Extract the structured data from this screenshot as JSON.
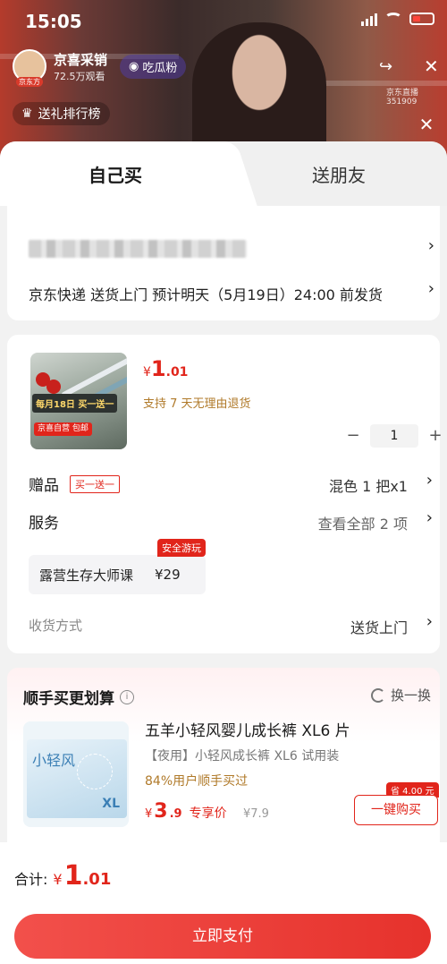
{
  "status_bar": {
    "time": "15:05"
  },
  "live": {
    "host_name": "京喜采销",
    "host_views": "72.5万观看",
    "follow_label": "吃瓜粉",
    "rank_label": "送礼排行榜",
    "live_id": "京东直播 351909"
  },
  "tabs": [
    {
      "label": "自己买"
    },
    {
      "label": "送朋友"
    }
  ],
  "address": {
    "delivery": "京东快递 送货上门 预计明天（5月19日）24:00 前发货"
  },
  "product": {
    "image_banner": "每月18日 买一送一",
    "image_tag": "京喜自营 包邮",
    "price_symbol": "¥",
    "price_int": "1",
    "price_dec": ".01",
    "return_note": "支持 7 天无理由退货",
    "quantity": "1",
    "minus": "−",
    "plus": "+"
  },
  "gift": {
    "label": "赠品",
    "badge": "买一送一",
    "value": "混色 1 把x1"
  },
  "service": {
    "label": "服务",
    "value": "查看全部 2 项",
    "chip_name": "露营生存大师课",
    "chip_price": "¥29",
    "chip_tag": "安全游玩"
  },
  "shipping": {
    "label": "收货方式",
    "value": "送货上门"
  },
  "upsell": {
    "title": "顺手买更划算",
    "swap_label": "换一换",
    "image_brand": "小轻风",
    "image_size": "XL",
    "name": "五羊小轻风婴儿成长裤 XL6 片",
    "subtitle": "【夜用】小轻风成长裤 XL6 试用装",
    "percent": "84%用户顺手买过",
    "price_symbol": "¥",
    "price_int": "3",
    "price_dec": ".9",
    "price_label": "专享价",
    "original_price": "¥7.9",
    "save_tag": "省 4.00 元",
    "buy_label": "一键购买"
  },
  "footer": {
    "total_label": "合计:",
    "total_symbol": "¥",
    "total_int": "1",
    "total_dec": ".01",
    "pay_label": "立即支付"
  },
  "colors": {
    "accent": "#e1251b",
    "pay_button": "#e6322c",
    "note_gold": "#b07a2a"
  }
}
